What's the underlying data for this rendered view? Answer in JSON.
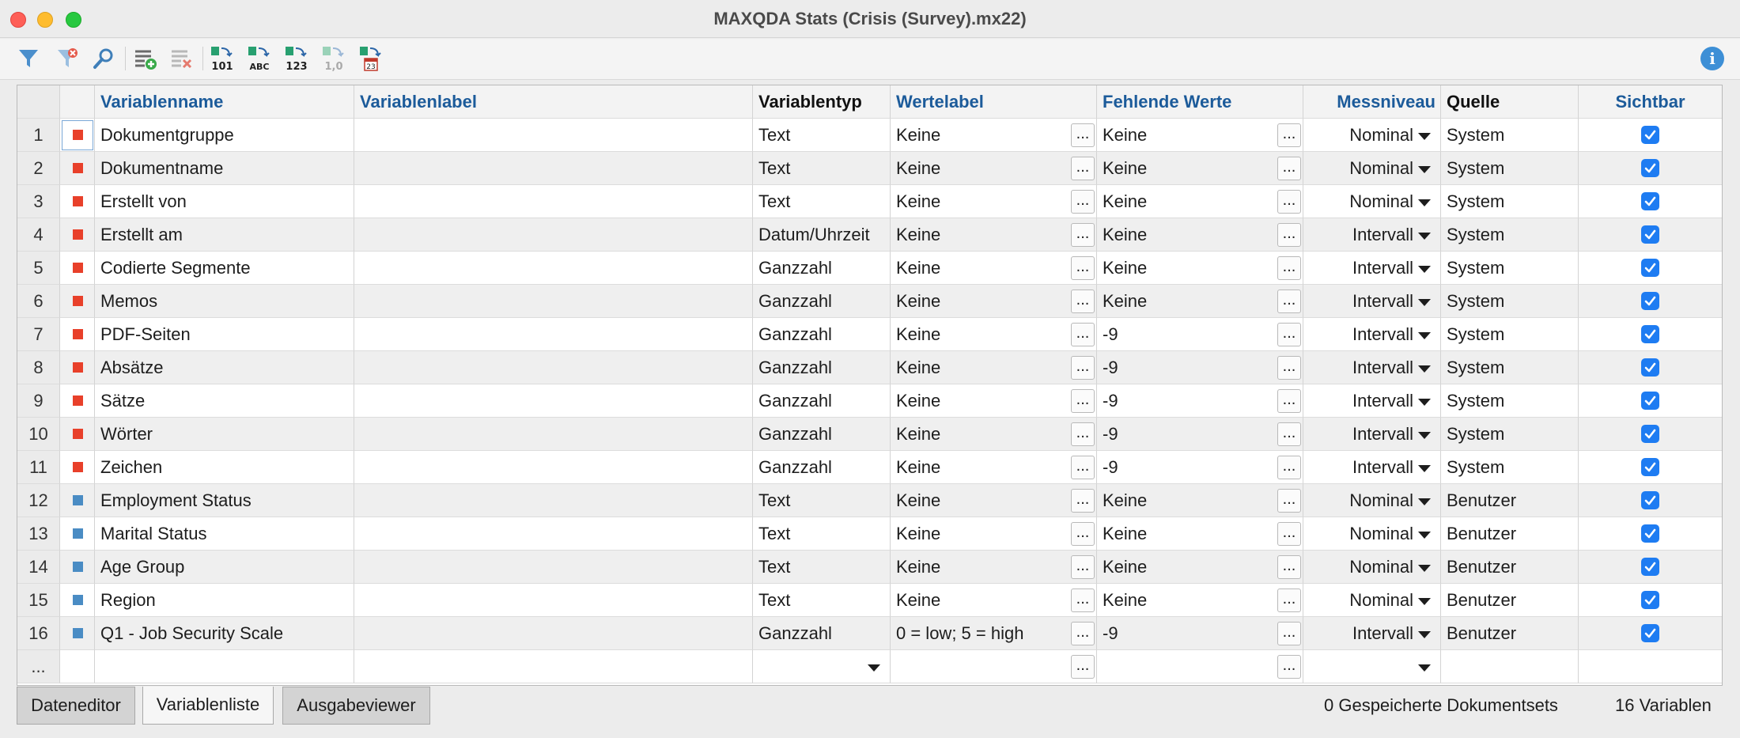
{
  "window": {
    "title": "MAXQDA Stats (Crisis (Survey).mx22)"
  },
  "toolbar": {
    "labels": {
      "b101": "101",
      "babc": "ABC",
      "b123": "123",
      "b10": "1,0",
      "b23": "23"
    }
  },
  "columns": {
    "name": "Variablenname",
    "label": "Variablenlabel",
    "type": "Variablentyp",
    "value_label": "Wertelabel",
    "missing": "Fehlende Werte",
    "level": "Messniveau",
    "source": "Quelle",
    "visible": "Sichtbar"
  },
  "dots_label": "...",
  "rows": [
    {
      "num": "1",
      "color": "red",
      "name": "Dokumentgruppe",
      "label": "",
      "type": "Text",
      "value_label": "Keine",
      "missing": "Keine",
      "level": "Nominal",
      "source": "System",
      "visible": true
    },
    {
      "num": "2",
      "color": "red",
      "name": "Dokumentname",
      "label": "",
      "type": "Text",
      "value_label": "Keine",
      "missing": "Keine",
      "level": "Nominal",
      "source": "System",
      "visible": true
    },
    {
      "num": "3",
      "color": "red",
      "name": "Erstellt von",
      "label": "",
      "type": "Text",
      "value_label": "Keine",
      "missing": "Keine",
      "level": "Nominal",
      "source": "System",
      "visible": true
    },
    {
      "num": "4",
      "color": "red",
      "name": "Erstellt am",
      "label": "",
      "type": "Datum/Uhrzeit",
      "value_label": "Keine",
      "missing": "Keine",
      "level": "Intervall",
      "source": "System",
      "visible": true
    },
    {
      "num": "5",
      "color": "red",
      "name": "Codierte Segmente",
      "label": "",
      "type": "Ganzzahl",
      "value_label": "Keine",
      "missing": "Keine",
      "level": "Intervall",
      "source": "System",
      "visible": true
    },
    {
      "num": "6",
      "color": "red",
      "name": "Memos",
      "label": "",
      "type": "Ganzzahl",
      "value_label": "Keine",
      "missing": "Keine",
      "level": "Intervall",
      "source": "System",
      "visible": true
    },
    {
      "num": "7",
      "color": "red",
      "name": "PDF-Seiten",
      "label": "",
      "type": "Ganzzahl",
      "value_label": "Keine",
      "missing": "-9",
      "level": "Intervall",
      "source": "System",
      "visible": true
    },
    {
      "num": "8",
      "color": "red",
      "name": "Absätze",
      "label": "",
      "type": "Ganzzahl",
      "value_label": "Keine",
      "missing": "-9",
      "level": "Intervall",
      "source": "System",
      "visible": true
    },
    {
      "num": "9",
      "color": "red",
      "name": "Sätze",
      "label": "",
      "type": "Ganzzahl",
      "value_label": "Keine",
      "missing": "-9",
      "level": "Intervall",
      "source": "System",
      "visible": true
    },
    {
      "num": "10",
      "color": "red",
      "name": "Wörter",
      "label": "",
      "type": "Ganzzahl",
      "value_label": "Keine",
      "missing": "-9",
      "level": "Intervall",
      "source": "System",
      "visible": true
    },
    {
      "num": "11",
      "color": "red",
      "name": "Zeichen",
      "label": "",
      "type": "Ganzzahl",
      "value_label": "Keine",
      "missing": "-9",
      "level": "Intervall",
      "source": "System",
      "visible": true
    },
    {
      "num": "12",
      "color": "blue",
      "name": "Employment Status",
      "label": "",
      "type": "Text",
      "value_label": "Keine",
      "missing": "Keine",
      "level": "Nominal",
      "source": "Benutzer",
      "visible": true
    },
    {
      "num": "13",
      "color": "blue",
      "name": "Marital Status",
      "label": "",
      "type": "Text",
      "value_label": "Keine",
      "missing": "Keine",
      "level": "Nominal",
      "source": "Benutzer",
      "visible": true
    },
    {
      "num": "14",
      "color": "blue",
      "name": "Age Group",
      "label": "",
      "type": "Text",
      "value_label": "Keine",
      "missing": "Keine",
      "level": "Nominal",
      "source": "Benutzer",
      "visible": true
    },
    {
      "num": "15",
      "color": "blue",
      "name": "Region",
      "label": "",
      "type": "Text",
      "value_label": "Keine",
      "missing": "Keine",
      "level": "Nominal",
      "source": "Benutzer",
      "visible": true
    },
    {
      "num": "16",
      "color": "blue",
      "name": "Q1 - Job Security Scale",
      "label": "",
      "type": "Ganzzahl",
      "value_label": "0 = low; 5 = high",
      "missing": "-9",
      "level": "Intervall",
      "source": "Benutzer",
      "visible": true
    }
  ],
  "new_row": {
    "num": "..."
  },
  "bottom": {
    "tabs": [
      {
        "label": "Dateneditor",
        "active": false
      },
      {
        "label": "Variablenliste",
        "active": true
      },
      {
        "label": "Ausgabeviewer",
        "active": false
      }
    ],
    "saved_sets": "0 Gespeicherte Dokumentsets",
    "var_count": "16 Variablen"
  },
  "colors": {
    "system": "#e8402a",
    "user": "#4a8cc4",
    "header_link": "#1c5b9a",
    "checkbox": "#1e7cf2"
  }
}
